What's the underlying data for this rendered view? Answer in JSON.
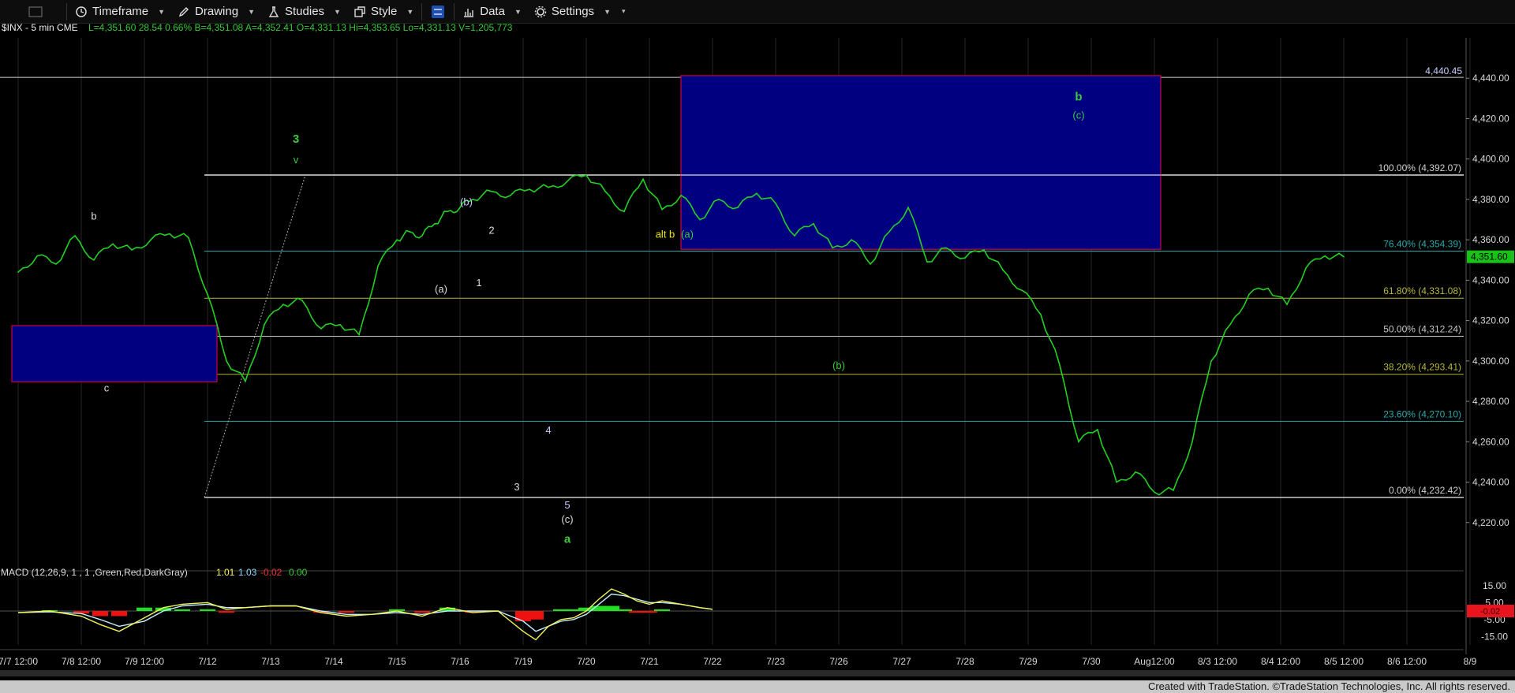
{
  "toolbar": {
    "timeframe": "Timeframe",
    "drawing": "Drawing",
    "studies": "Studies",
    "style": "Style",
    "data": "Data",
    "settings": "Settings"
  },
  "header": {
    "symbol": "$INX - 5 min  CME",
    "quote": "L=4,351.60  28.54  0.66%  B=4,351.08  A=4,352.41  O=4,331.13  Hi=4,353.65  Lo=4,331.13  V=1,205,773"
  },
  "footer": "Created with TradeStation. ©TradeStation Technologies, Inc. All rights reserved.",
  "colors": {
    "price": "#22d022",
    "box": "#000080",
    "box_border": "#c8004a",
    "macd_line": "#f2f25a",
    "macd_signal": "#bfefff",
    "hist_pos": "#22dd22",
    "hist_neg": "#ee1111",
    "last_price_bg": "#19c219",
    "macd_last_bg": "#e8141e"
  },
  "chart_data": {
    "type": "line",
    "title": "$INX - 5 min",
    "ylim": [
      4200,
      4460
    ],
    "price_axis_ticks": [
      4220,
      4240,
      4260,
      4280,
      4300,
      4320,
      4340,
      4360,
      4380,
      4400,
      4420,
      4440
    ],
    "price_axis_labels": [
      "4,220.00",
      "4,240.00",
      "4,260.00",
      "4,280.00",
      "4,300.00",
      "4,320.00",
      "4,340.00",
      "4,360.00",
      "4,380.00",
      "4,400.00",
      "4,420.00",
      "4,440.00"
    ],
    "x_labels": [
      "7/7 12:00",
      "7/8 12:00",
      "7/9 12:00",
      "7/12",
      "7/13",
      "7/14",
      "7/15",
      "7/16",
      "7/19",
      "7/20",
      "7/21",
      "7/22",
      "7/23",
      "7/26",
      "7/27",
      "7/28",
      "7/29",
      "7/30",
      "Aug12:00",
      "8/3 12:00",
      "8/4 12:00",
      "8/5 12:00",
      "8/6 12:00",
      "8/9"
    ],
    "series": [
      {
        "name": "$INX",
        "t": [
          0,
          0.3,
          0.6,
          0.9,
          1.2,
          1.5,
          1.8,
          2.1,
          2.4,
          2.7,
          3.0,
          3.3,
          3.6,
          3.9,
          4.2,
          4.5,
          4.8,
          5.1,
          5.4,
          5.7,
          6.0,
          6.2,
          6.4,
          6.6,
          6.8,
          7.0,
          7.2,
          7.5,
          7.8,
          8.1,
          8.4,
          8.7,
          9.0,
          9.3,
          9.6,
          9.9,
          10.2,
          10.5,
          10.8,
          11.1,
          11.4,
          11.7,
          12.0,
          12.3,
          12.6,
          12.9,
          13.2,
          13.5,
          13.8,
          14.1,
          14.4,
          14.7,
          15.0,
          15.3,
          15.6,
          15.9,
          16.2,
          16.5,
          16.8,
          17.1,
          17.4,
          17.7,
          18.0,
          18.3,
          18.6,
          18.9,
          19.2,
          19.5,
          19.8,
          20.1,
          20.4,
          20.7,
          21.0
        ],
        "values": [
          4344,
          4352,
          4348,
          4362,
          4350,
          4358,
          4355,
          4360,
          4363,
          4361,
          4333,
          4300,
          4290,
          4318,
          4328,
          4330,
          4316,
          4318,
          4313,
          4347,
          4360,
          4364,
          4362,
          4368,
          4374,
          4376,
          4380,
          4384,
          4382,
          4385,
          4386,
          4389,
          4392,
          4384,
          4374,
          4390,
          4375,
          4382,
          4370,
          4380,
          4376,
          4383,
          4378,
          4362,
          4368,
          4356,
          4360,
          4348,
          4364,
          4376,
          4349,
          4356,
          4351,
          4355,
          4345,
          4335,
          4323,
          4298,
          4260,
          4266,
          4240,
          4245,
          4235,
          4236,
          4260,
          4300,
          4318,
          4333,
          4336,
          4328,
          4346,
          4352,
          4351.6
        ]
      }
    ],
    "fib_levels": [
      {
        "label": "100.00% (4,392.07)",
        "value": 4392.07,
        "color": "#dddddd"
      },
      {
        "label": "76.40% (4,354.39)",
        "value": 4354.39,
        "color": "#2aa7a7"
      },
      {
        "label": "61.80% (4,331.08)",
        "value": 4331.08,
        "color": "#b7b73a"
      },
      {
        "label": "50.00% (4,312.24)",
        "value": 4312.24,
        "color": "#c8c8c8"
      },
      {
        "label": "38.20% (4,293.41)",
        "value": 4293.41,
        "color": "#b7b73a"
      },
      {
        "label": "23.60% (4,270.10)",
        "value": 4270.1,
        "color": "#2aa7a7"
      },
      {
        "label": "0.00% (4,232.42)",
        "value": 4232.42,
        "color": "#dddddd"
      }
    ],
    "hline": {
      "label": "4,440.45",
      "value": 4440.45
    },
    "last_price": "4,351.60",
    "wave_labels": [
      {
        "text": "b",
        "t": 1.2,
        "v": 4370,
        "color": "#dddddd"
      },
      {
        "text": "c",
        "t": 1.4,
        "v": 4285,
        "color": "#dddddd"
      },
      {
        "text": "3",
        "t": 4.4,
        "v": 4408,
        "color": "#3ec83e"
      },
      {
        "text": "v",
        "t": 4.4,
        "v": 4398,
        "color": "#3ec83e"
      },
      {
        "text": "(b)",
        "t": 7.1,
        "v": 4377,
        "color": "#c8c8ff"
      },
      {
        "text": "2",
        "t": 7.5,
        "v": 4363,
        "color": "#dddddd"
      },
      {
        "text": "(a)",
        "t": 6.7,
        "v": 4334,
        "color": "#dddddd"
      },
      {
        "text": "1",
        "t": 7.3,
        "v": 4337,
        "color": "#dddddd"
      },
      {
        "text": "4",
        "t": 8.4,
        "v": 4264,
        "color": "#c8c8ff"
      },
      {
        "text": "3",
        "t": 7.9,
        "v": 4236,
        "color": "#dddddd"
      },
      {
        "text": "5",
        "t": 8.7,
        "v": 4227,
        "color": "#c8c8ff"
      },
      {
        "text": "(c)",
        "t": 8.7,
        "v": 4220,
        "color": "#dddddd"
      },
      {
        "text": "a",
        "t": 8.7,
        "v": 4210,
        "color": "#3ec83e"
      },
      {
        "text": "alt b",
        "t": 10.25,
        "v": 4361,
        "color": "#e8e800"
      },
      {
        "text": "(a)",
        "t": 10.6,
        "v": 4361,
        "color": "#3ec83e"
      },
      {
        "text": "(b)",
        "t": 13.0,
        "v": 4296,
        "color": "#3ec83e"
      },
      {
        "text": "b",
        "t": 16.8,
        "v": 4429,
        "color": "#3ec83e"
      },
      {
        "text": "(c)",
        "t": 16.8,
        "v": 4420,
        "color": "#3ec83e"
      }
    ],
    "target_box": {
      "t_start": 10.5,
      "t_end": 18.1,
      "top": 4441.3,
      "bottom": 4355.3
    },
    "left_box": {
      "t_start": -0.1,
      "t_end": 3.15,
      "top": 4317.5,
      "bottom": 4289.7
    },
    "macd": {
      "label": "MACD (12,26,9, 1 , 1 ,Green,Red,DarkGray)",
      "values_text": [
        "1.01",
        "1.03",
        "-0.02",
        "0.00"
      ],
      "ylim": [
        -20,
        20
      ],
      "ticks": [
        "15.00",
        "5.00",
        "-5.00",
        "-15.00"
      ],
      "last": "-0.02",
      "t": [
        0,
        0.5,
        1.0,
        1.3,
        1.6,
        2.0,
        2.3,
        2.6,
        3.0,
        3.3,
        3.6,
        4.0,
        4.4,
        4.8,
        5.2,
        5.6,
        6.0,
        6.4,
        6.8,
        7.2,
        7.6,
        8.0,
        8.2,
        8.4,
        8.6,
        8.8,
        9.0,
        9.2,
        9.4,
        9.6,
        9.8,
        10.0,
        10.2,
        10.5,
        10.8,
        11.0
      ],
      "macd": [
        -1,
        0,
        -3,
        -8,
        -12,
        -4,
        2,
        4,
        5,
        1,
        2,
        3,
        3,
        -1,
        -3,
        -2,
        0,
        -3,
        2,
        -1,
        0,
        -12,
        -17,
        -9,
        -5,
        -4,
        0,
        7,
        13,
        10,
        6,
        4,
        6,
        4,
        2,
        1.01
      ],
      "signal": [
        -1,
        -0.5,
        -1.5,
        -5,
        -9,
        -6,
        0,
        3,
        4,
        2,
        2,
        3,
        3,
        0,
        -2,
        -2,
        -1,
        -2,
        0,
        0,
        0,
        -6,
        -12,
        -9,
        -6,
        -5,
        -2,
        4,
        10,
        9,
        7,
        5,
        5,
        4,
        2,
        1.03
      ],
      "hist": [
        0,
        0.5,
        -1.5,
        -3,
        -3,
        2,
        2,
        1,
        1,
        -1,
        0,
        0,
        0,
        -1,
        -1,
        0,
        1,
        -1,
        2,
        -1,
        0,
        -6,
        -5,
        0,
        1,
        1,
        2,
        3,
        3,
        1,
        -1,
        -1,
        1,
        0,
        0,
        -0.02
      ]
    }
  }
}
